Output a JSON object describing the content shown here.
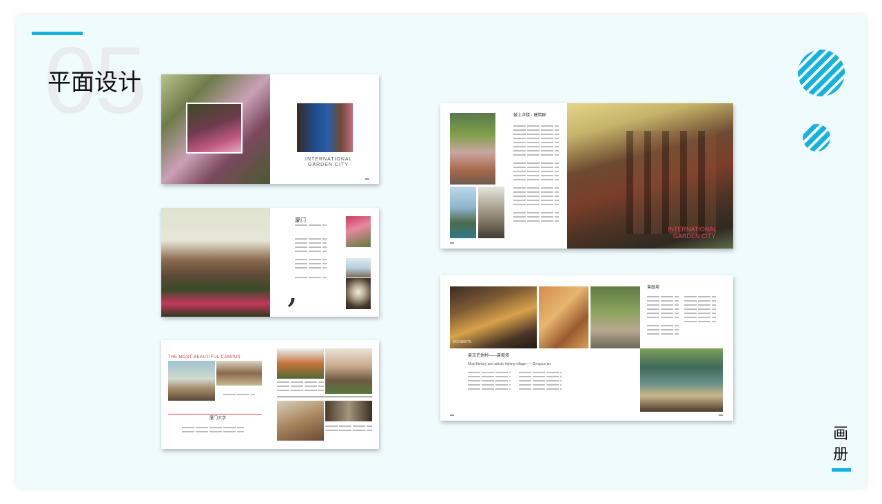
{
  "slide": {
    "number": "05",
    "title": "平面设计",
    "vertical_label": "画册",
    "accent_color": "#12b3e0"
  },
  "spread1": {
    "caption_line1": "INTERNATIONAL",
    "caption_line2": "GARDEN CITY"
  },
  "spread2": {
    "heading": "厦门",
    "quote_mark": ","
  },
  "spread3": {
    "headline": "THE MOST BEAUTIFUL CAMPUS",
    "subheading": "厦门大学"
  },
  "spread4": {
    "heading": "鼓上洋楼 · 建筑群",
    "overlay_line1": "INTERNATIONAL",
    "overlay_line2": "GARDEN CITY"
  },
  "spread5": {
    "heading": "曾厝垵",
    "subtitle": "曾文艺他村——曾厝垵",
    "subtitle_en": "Most literary and artistic fishing village——Zengcuo'an",
    "sign_text": "VOYSEETS"
  }
}
